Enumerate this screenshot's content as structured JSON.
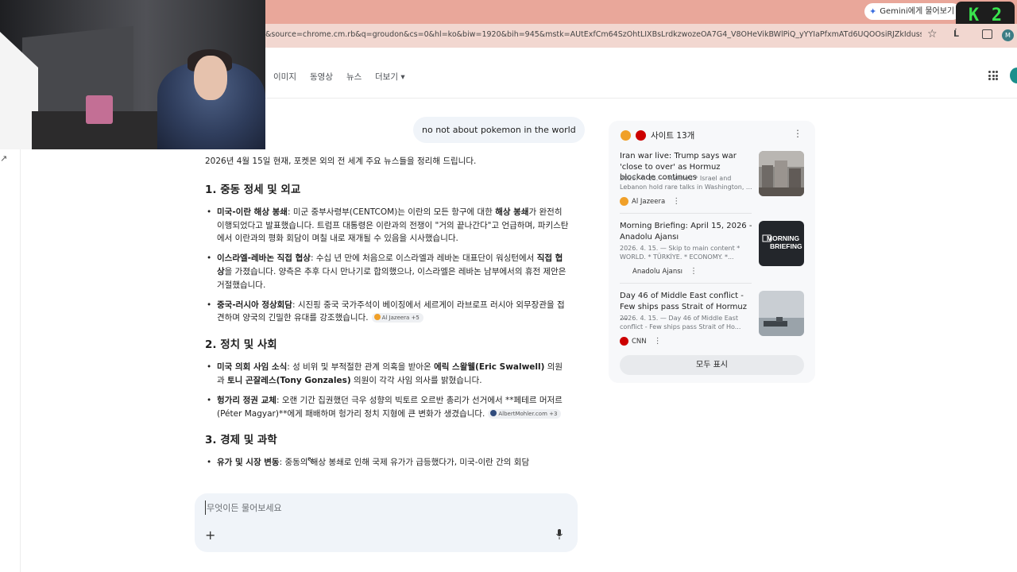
{
  "browser": {
    "gemini_label": "Gemini에게 물어보기",
    "badge_letter": "K",
    "badge_number": "2",
    "url": "&source=chrome.cm.rb&q=groudon&cs=0&hl=ko&biw=1920&bih=945&mstk=AUtExfCm64SzOhtLIXBsLrdkzwozeOA7G4_V8OHeVikBWlPiQ_yYYIaPfxmATd6UQOOsiRJZkIdussoiRPYDYK...",
    "translate_label": "Ĺ"
  },
  "nav": {
    "tabs": [
      "이미지",
      "동영상",
      "뉴스",
      "더보기 ▾"
    ]
  },
  "chat": {
    "user_message": "no not about pokemon in the world",
    "intro": "2026년 4월 15일 현재, 포켓몬 외의 전 세계 주요 뉴스들을 정리해 드립니다.",
    "s1_title": "1. 중동 정세 및 외교",
    "s1_i1_bold": "미국-이란 해상 봉쇄",
    "s1_i1_a": ": 미군 중부사령부(CENTCOM)는 이란의 모든 항구에 대한 ",
    "s1_i1_bold2": "해상 봉쇄",
    "s1_i1_b": "가 완전히 이행되었다고 발표했습니다. 트럼프 대통령은 이란과의 전쟁이 \"거의 끝나간다\"고 언급하며, 파키스탄에서 이란과의 평화 회담이 며칠 내로 재개될 수 있음을 시사했습니다.",
    "s1_i2_bold": "이스라엘-레바논 직접 협상",
    "s1_i2_a": ": 수십 년 만에 처음으로 이스라엘과 레바논 대표단이 워싱턴에서 ",
    "s1_i2_bold2": "직접 협상",
    "s1_i2_b": "을 가졌습니다. 양측은 추후 다시 만나기로 합의했으나, 이스라엘은 레바논 남부에서의 휴전 제안은 거절했습니다.",
    "s1_i3_bold": "중국-러시아 정상회담",
    "s1_i3_a": ": 시진핑 중국 국가주석이 베이징에서 세르게이 라브로프 러시아 외무장관을 접견하며 양국의 긴밀한 유대를 강조했습니다.",
    "s1_chip": "Al Jazeera +5",
    "s2_title": "2. 정치 및 사회",
    "s2_i1_bold": "미국 의회 사임 소식",
    "s2_i1_a": ": 성 비위 및 부적절한 관계 의혹을 받아온 ",
    "s2_i1_bold2": "에릭 스왈웰(Eric Swalwell)",
    "s2_i1_b": " 의원과 ",
    "s2_i1_bold3": "토니 곤잘레스(Tony Gonzales)",
    "s2_i1_c": " 의원이 각각 사임 의사를 밝혔습니다.",
    "s2_i2_bold": "헝가리 정권 교체",
    "s2_i2_a": ": 오랜 기간 집권했던 극우 성향의 빅토르 오르반 총리가 선거에서 **페테르 머저르(Péter Magyar)**에게 패배하며 헝가리 정치 지형에 큰 변화가 생겼습니다.",
    "s2_chip": "AlbertMohler.com +3",
    "s3_title": "3. 경제 및 과학",
    "s3_i1_bold": "유가 및 시장 변동",
    "s3_i1_a": ": 중동의 해상 봉쇄로 인해 국제 유가가 급등했다가, 미국-이란 간의 회담"
  },
  "prompt": {
    "placeholder": "무엇이든 물어보세요",
    "plus_glyph": "+"
  },
  "sources": {
    "header": "사이트 13개",
    "more_glyph": "⋮",
    "cards": [
      {
        "title": "Iran war live: Trump says war 'close to over' as Hormuz blockade continues",
        "snippet": "2026. 4. 15. — Related * Israel and Lebanon hold rare talks in Washington, ...",
        "publisher": "Al Jazeera"
      },
      {
        "title": "Morning Briefing: April 15, 2026 - Anadolu Ajansı",
        "snippet": "2026. 4. 15. — Skip to main content * WORLD. * TÜRKİYE. * ECONOMY. *...",
        "publisher": "Anadolu Ajansı",
        "thumb_text_1": "MORNING",
        "thumb_text_2": "BRIEFING"
      },
      {
        "title": "Day 46 of Middle East conflict - Few ships pass Strait of Hormuz ...",
        "snippet": "2026. 4. 15. — Day 46 of Middle East conflict - Few ships pass Strait of Ho...",
        "publisher": "CNN"
      }
    ],
    "show_all": "모두 표시"
  },
  "colors": {
    "tabbar": "#e9a79a",
    "addrbar": "#f2d7d0",
    "badge_text": "#39e34d",
    "bubble": "#f0f4f9",
    "aljazeera": "#f0a029",
    "cnn": "#cc0000"
  }
}
